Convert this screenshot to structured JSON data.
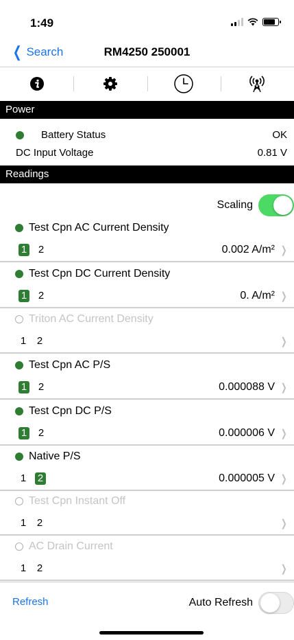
{
  "status": {
    "time": "1:49"
  },
  "nav": {
    "back_label": "Search",
    "title": "RM4250 250001"
  },
  "toolbar": {
    "icons": [
      "info-icon",
      "gear-icon",
      "clock-icon",
      "broadcast-icon"
    ]
  },
  "power": {
    "header": "Power",
    "battery_label": "Battery Status",
    "battery_value": "OK",
    "dc_label": "DC Input Voltage",
    "dc_value": "0.81 V"
  },
  "readings": {
    "header": "Readings",
    "scaling_label": "Scaling",
    "scaling_on": true,
    "items": [
      {
        "name": "Test Cpn AC Current Density",
        "ch1": "1",
        "ch2": "2",
        "active": 1,
        "value": "0.002 A/m²",
        "enabled": true
      },
      {
        "name": "Test Cpn DC Current Density",
        "ch1": "1",
        "ch2": "2",
        "active": 1,
        "value": "0. A/m²",
        "enabled": true
      },
      {
        "name": "Triton AC Current Density",
        "ch1": "1",
        "ch2": "2",
        "active": 0,
        "value": "",
        "enabled": false
      },
      {
        "name": "Test Cpn AC P/S",
        "ch1": "1",
        "ch2": "2",
        "active": 1,
        "value": "0.000088 V",
        "enabled": true
      },
      {
        "name": "Test Cpn DC P/S",
        "ch1": "1",
        "ch2": "2",
        "active": 1,
        "value": "0.000006 V",
        "enabled": true
      },
      {
        "name": "Native P/S",
        "ch1": "1",
        "ch2": "2",
        "active": 2,
        "value": "0.000005 V",
        "enabled": true
      },
      {
        "name": "Test Cpn Instant Off",
        "ch1": "1",
        "ch2": "2",
        "active": 0,
        "value": "",
        "enabled": false
      },
      {
        "name": "AC Drain Current",
        "ch1": "1",
        "ch2": "2",
        "active": 0,
        "value": "",
        "enabled": false
      }
    ]
  },
  "footer": {
    "refresh_label": "Refresh",
    "auto_refresh_label": "Auto Refresh",
    "auto_refresh_on": false
  },
  "colors": {
    "accent": "#1a73e8",
    "active_green": "#2e7d32",
    "toggle_green": "#4cd964"
  }
}
